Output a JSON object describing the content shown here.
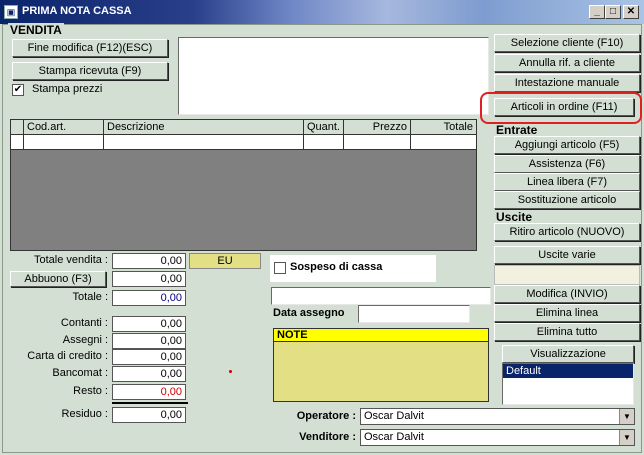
{
  "window": {
    "title": "PRIMA NOTA CASSA",
    "minimize_glyph": "_",
    "maximize_glyph": "□",
    "close_glyph": "✕"
  },
  "section": {
    "label": "VENDITA"
  },
  "left_buttons": {
    "fine_modifica": "Fine modifica (F12)(ESC)",
    "stampa_ricevuta": "Stampa ricevuta (F9)",
    "stampa_prezzi": "Stampa prezzi",
    "stampa_prezzi_checked": true
  },
  "grid": {
    "columns": [
      "Cod.art.",
      "Descrizione",
      "Quant.",
      "Prezzo",
      "Totale"
    ]
  },
  "right_buttons": {
    "selezione_cliente": "Selezione cliente (F10)",
    "annulla_rif": "Annulla rif. a cliente",
    "intestazione_manuale": "Intestazione manuale",
    "articoli_in_ordine": "Articoli in ordine (F11)",
    "entrate_header": "Entrate",
    "aggiungi_articolo": "Aggiungi articolo (F5)",
    "assistenza": "Assistenza (F6)",
    "linea_libera": "Linea libera (F7)",
    "sostituzione_articolo": "Sostituzione articolo",
    "uscite_header": "Uscite",
    "ritiro_articolo": "Ritiro articolo (NUOVO)",
    "uscite_varie": "Uscite varie",
    "modifica": "Modifica (INVIO)",
    "elimina_linea": "Elimina linea",
    "elimina_tutto": "Elimina tutto"
  },
  "totals": {
    "totale_vendita_label": "Totale vendita :",
    "totale_vendita": "0,00",
    "currency": "EU",
    "abbuono_label": "Abbuono (F3)",
    "abbuono": "0,00",
    "totale_label": "Totale :",
    "totale": "0,00",
    "contanti_label": "Contanti :",
    "contanti": "0,00",
    "assegni_label": "Assegni :",
    "assegni": "0,00",
    "carta_label": "Carta di credito :",
    "carta": "0,00",
    "bancomat_label": "Bancomat :",
    "bancomat": "0,00",
    "resto_label": "Resto :",
    "resto": "0,00",
    "residuo_label": "Residuo :",
    "residuo": "0,00"
  },
  "middle": {
    "sospeso_label": "Sospeso di cassa",
    "sospeso_checked": false,
    "data_assegno_label": "Data assegno",
    "note_label": "NOTE"
  },
  "visualizzazione": {
    "label": "Visualizzazione",
    "selected": "Default"
  },
  "people": {
    "operatore_label": "Operatore :",
    "operatore_value": "Oscar Dalvit",
    "venditore_label": "Venditore :",
    "venditore_value": "Oscar Dalvit"
  },
  "colors": {
    "background": "#d4dfd4",
    "title_bar": "#0a246a",
    "note_yellow": "#ffff00",
    "note_body": "#e2df84",
    "currency_box": "#e2df84",
    "resto_red": "#cc0000",
    "highlight_red": "#e02020",
    "selection_blue": "#0a246a"
  }
}
